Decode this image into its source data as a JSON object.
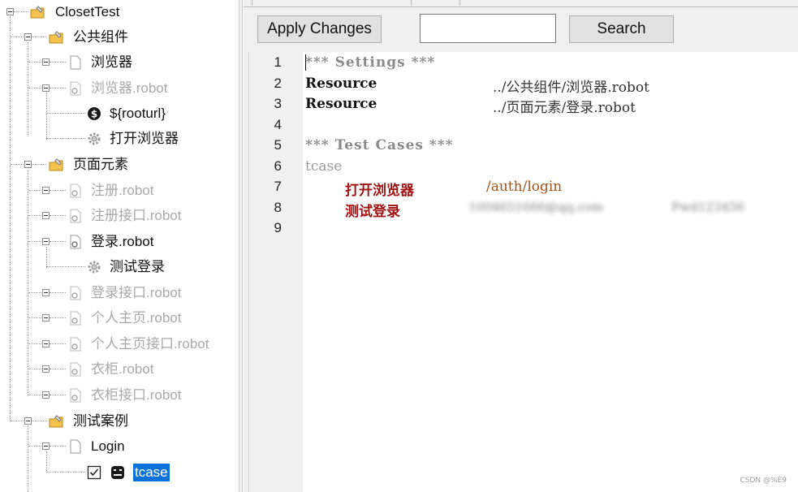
{
  "tree": {
    "nodes": [
      {
        "label": "ClosetTest",
        "icon": "folder-edit-icon",
        "dim": false
      },
      {
        "label": "公共组件",
        "icon": "folder-edit-icon",
        "dim": false
      },
      {
        "label": "浏览器",
        "icon": "file-icon",
        "dim": false
      },
      {
        "label": "浏览器.robot",
        "icon": "resource-file-icon",
        "dim": true
      },
      {
        "label": "${rooturl}",
        "icon": "dollar-icon",
        "dim": false
      },
      {
        "label": "打开浏览器",
        "icon": "gear-icon",
        "dim": false
      },
      {
        "label": "页面元素",
        "icon": "folder-edit-icon",
        "dim": false
      },
      {
        "label": "注册.robot",
        "icon": "resource-file-icon",
        "dim": true
      },
      {
        "label": "注册接口.robot",
        "icon": "resource-file-icon",
        "dim": true
      },
      {
        "label": "登录.robot",
        "icon": "resource-file-icon",
        "dim": false
      },
      {
        "label": "测试登录",
        "icon": "gear-icon",
        "dim": false
      },
      {
        "label": "登录接口.robot",
        "icon": "resource-file-icon",
        "dim": true
      },
      {
        "label": "个人主页.robot",
        "icon": "resource-file-icon",
        "dim": true
      },
      {
        "label": "个人主页接口.robot",
        "icon": "resource-file-icon",
        "dim": true
      },
      {
        "label": "衣柜.robot",
        "icon": "resource-file-icon",
        "dim": true
      },
      {
        "label": "衣柜接口.robot",
        "icon": "resource-file-icon",
        "dim": true
      },
      {
        "label": "测试案例",
        "icon": "folder-edit-icon",
        "dim": false
      },
      {
        "label": "Login",
        "icon": "file-icon",
        "dim": false
      },
      {
        "label": "tcase",
        "icon": "robot-icon",
        "dim": false,
        "selected": true,
        "checked": true
      }
    ]
  },
  "toolbar": {
    "apply_label": "Apply Changes",
    "search_value": "",
    "search_label": "Search"
  },
  "editor": {
    "line_numbers": [
      "1",
      "2",
      "3",
      "4",
      "5",
      "6",
      "7",
      "8",
      "9"
    ],
    "lines": {
      "l1": "*** Settings ***",
      "l2_kw": "Resource",
      "l2_path": "../公共组件/浏览器.robot",
      "l3_kw": "Resource",
      "l3_path": "../页面元素/登录.robot",
      "l5": "*** Test Cases ***",
      "l6": "tcase",
      "l7_kw": "打开浏览器",
      "l7_arg": "/auth/login",
      "l8_kw": "测试登录",
      "l8_arg1": "1004651666@qq.com",
      "l8_arg2": "Pwd123456"
    }
  },
  "watermark": "CSDN @%E9",
  "colors": {
    "selection": "#0a72d8",
    "keyword_user": "#a01212",
    "argument": "#a0551a",
    "section": "#8a8a8a"
  }
}
